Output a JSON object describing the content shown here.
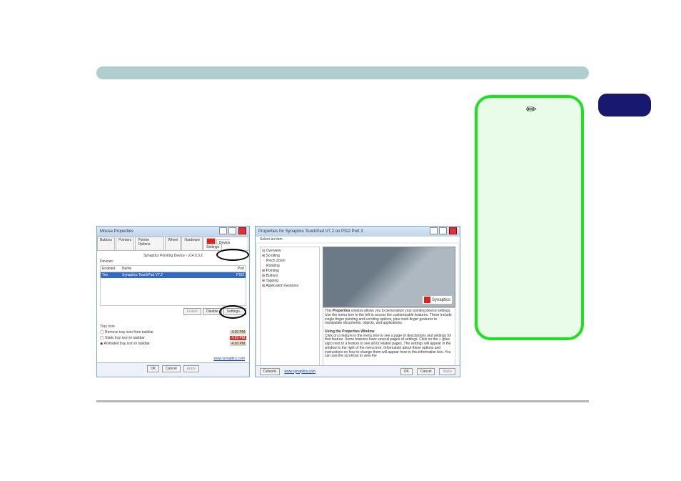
{
  "header": {
    "title_text": ""
  },
  "note": {
    "icon": "pen-icon"
  },
  "mouse_properties": {
    "window_title": "Mouse Properties",
    "tabs": [
      "Buttons",
      "Pointers",
      "Pointer Options",
      "Wheel",
      "Hardware",
      "Device Settings"
    ],
    "active_tab_index": 5,
    "driver_line": "Synaptics Pointing Device - v14.0.3.2",
    "devices_label": "Devices:",
    "col_enabled": "Enabled",
    "col_name": "Name",
    "col_port": "Port",
    "row_enabled": "Yes",
    "row_name": "Synaptics TouchPad V7.2",
    "row_port": "PS/2",
    "btn_enable": "Enable",
    "btn_disable": "Disable",
    "btn_settings": "Settings...",
    "tray_label": "Tray Icon",
    "tray_opt1": "Remove tray icon from taskbar",
    "tray_opt2": "Static tray icon in taskbar",
    "tray_opt3": "Animated tray icon in taskbar",
    "time": "4:20 PM",
    "link": "www.synaptics.com",
    "ok": "OK",
    "cancel": "Cancel",
    "apply": "Apply"
  },
  "synaptics_properties": {
    "window_title": "Properties for Synaptics TouchPad V7.2 on PS/2 Port 3",
    "select_label": "Select an item",
    "tree": {
      "overview": "Overview",
      "scrolling": "Scrolling",
      "pinch": "Pinch Zoom",
      "rotating": "Rotating",
      "pointing": "Pointing",
      "buttons": "Buttons",
      "tapping": "Tapping",
      "app_gest": "Application Gestures"
    },
    "logo_text": "Synaptics",
    "desc_line1_prefix": "This ",
    "desc_line1_bold": "Properties",
    "desc_line1_rest": " window allows you to personalize your pointing device settings. Use the menu tree to the left to access the customizable features. These include single-finger pointing and scrolling options, plus multi-finger gestures to manipulate documents, objects, and applications.",
    "desc_head2": "Using the Properties Window",
    "desc_line2": "Click on a feature in the menu tree to see a page of descriptions and settings for that feature. Some features have several pages of settings. Click on the + (plus sign) next to a feature to see all its related pages. The settings will appear in the window to the right of the menu tree. Information about these options and instructions on how to change them will appear here in this information box. You can use the scroll bar to view the",
    "defaults": "Defaults",
    "link": "www.synaptics.com",
    "ok": "OK",
    "cancel": "Cancel",
    "apply": "Apply"
  }
}
